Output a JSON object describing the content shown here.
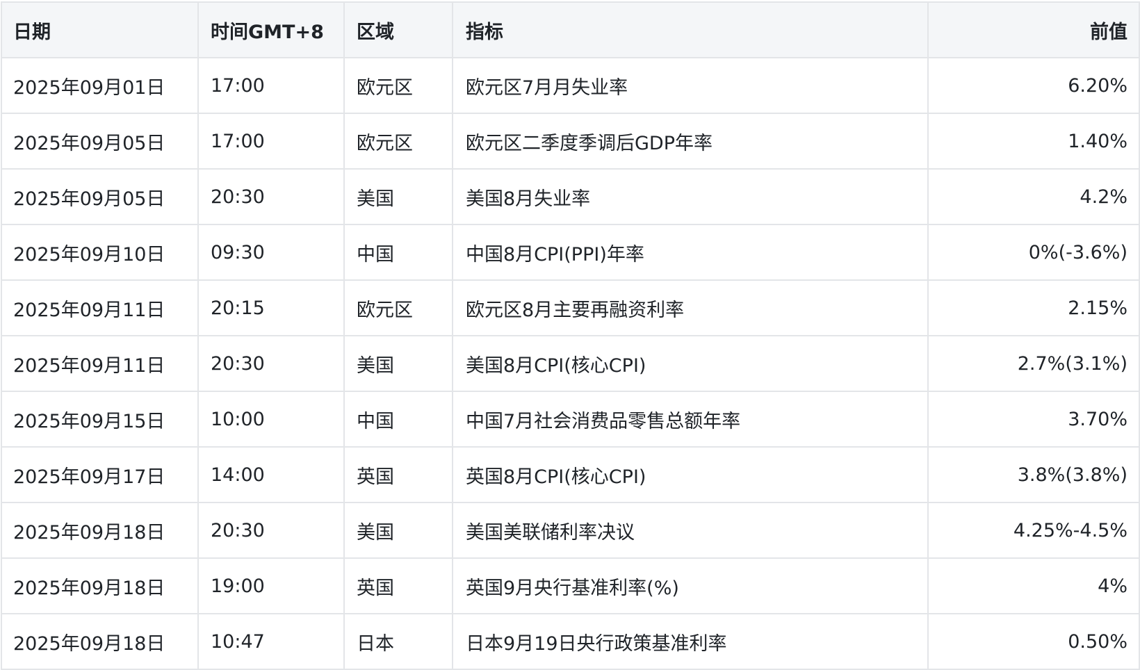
{
  "columns": {
    "date": "日期",
    "time": "时间GMT+8",
    "region": "区域",
    "indicator": "指标",
    "previous": "前值"
  },
  "rows": [
    {
      "date": "2025年09月01日",
      "time": "17:00",
      "region": "欧元区",
      "indicator": "欧元区7月月失业率",
      "previous": "6.20%"
    },
    {
      "date": "2025年09月05日",
      "time": "17:00",
      "region": "欧元区",
      "indicator": "欧元区二季度季调后GDP年率",
      "previous": "1.40%"
    },
    {
      "date": "2025年09月05日",
      "time": "20:30",
      "region": "美国",
      "indicator": "美国8月失业率",
      "previous": "4.2%"
    },
    {
      "date": "2025年09月10日",
      "time": "09:30",
      "region": "中国",
      "indicator": "中国8月CPI(PPI)年率",
      "previous": "0%(-3.6%)"
    },
    {
      "date": "2025年09月11日",
      "time": "20:15",
      "region": "欧元区",
      "indicator": "欧元区8月主要再融资利率",
      "previous": "2.15%"
    },
    {
      "date": "2025年09月11日",
      "time": "20:30",
      "region": "美国",
      "indicator": "美国8月CPI(核心CPI)",
      "previous": "2.7%(3.1%)"
    },
    {
      "date": "2025年09月15日",
      "time": "10:00",
      "region": "中国",
      "indicator": "中国7月社会消费品零售总额年率",
      "previous": "3.70%"
    },
    {
      "date": "2025年09月17日",
      "time": "14:00",
      "region": "英国",
      "indicator": "英国8月CPI(核心CPI)",
      "previous": "3.8%(3.8%)"
    },
    {
      "date": "2025年09月18日",
      "time": "20:30",
      "region": "美国",
      "indicator": "美国美联储利率决议",
      "previous": "4.25%-4.5%"
    },
    {
      "date": "2025年09月18日",
      "time": "19:00",
      "region": "英国",
      "indicator": "英国9月央行基准利率(%)",
      "previous": "4%"
    },
    {
      "date": "2025年09月18日",
      "time": "10:47",
      "region": "日本",
      "indicator": "日本9月19日央行政策基准利率",
      "previous": "0.50%"
    }
  ],
  "colors": {
    "header_background": "#f4f6f8",
    "border": "#e3e5e8",
    "text": "#1f2328",
    "dotted_underline": "#8a8f96"
  }
}
